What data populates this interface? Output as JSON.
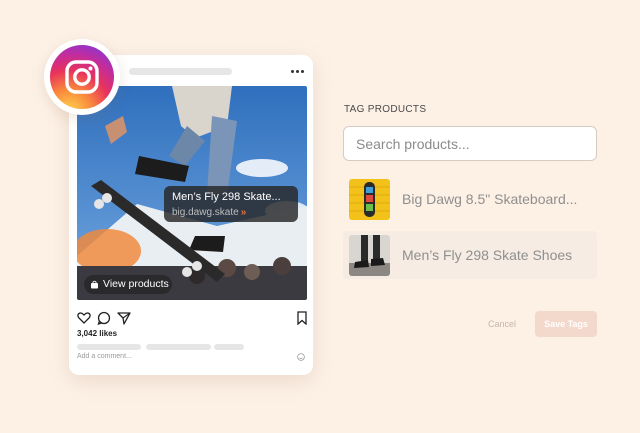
{
  "post": {
    "tag_product_name": "Men’s Fly 298 Skate...",
    "tag_store": "big.dawg.skate",
    "tag_arrows": "»",
    "view_products_label": "View products",
    "likes": "3,042 likes",
    "comment_placeholder": "Add a comment..."
  },
  "panel": {
    "title": "TAG PRODUCTS",
    "search_placeholder": "Search products...",
    "products": [
      {
        "label": "Big Dawg 8.5\" Skateboard...",
        "thumb_icon": "skateboard-deck-thumbnail"
      },
      {
        "label": "Men’s Fly 298 Skate Shoes",
        "thumb_icon": "skate-shoes-thumbnail"
      }
    ],
    "cancel_label": "Cancel",
    "save_label": "Save Tags"
  },
  "colors": {
    "background": "#fdf1e6",
    "save_button": "#f3d8cc",
    "tag_arrows": "#e8703a",
    "selected_row": "#f6ece4"
  },
  "icons": [
    "instagram-logo-icon",
    "more-options-icon",
    "heart-icon",
    "comment-icon",
    "share-icon",
    "bookmark-icon",
    "shopping-bag-icon",
    "emoji-icon"
  ]
}
